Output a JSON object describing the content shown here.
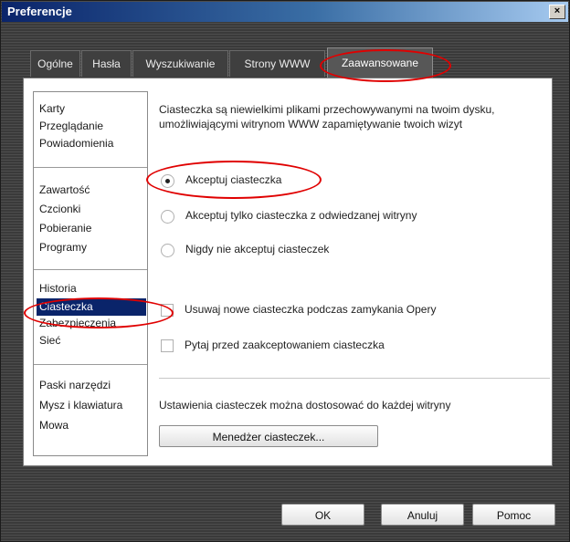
{
  "window": {
    "title": "Preferencje",
    "close_glyph": "×"
  },
  "tabs": [
    "Ogólne",
    "Hasła",
    "Wyszukiwanie",
    "Strony WWW",
    "Zaawansowane"
  ],
  "sidebar": {
    "groups": [
      [
        "Karty",
        "Przeglądanie",
        "Powiadomienia"
      ],
      [
        "Zawartość",
        "Czcionki",
        "Pobieranie",
        "Programy"
      ],
      [
        "Historia",
        "Ciasteczka",
        "Zabezpieczenia",
        "Sieć"
      ],
      [
        "Paski narzędzi",
        "Mysz i klawiatura",
        "Mowa"
      ]
    ],
    "selected": "Ciasteczka"
  },
  "content": {
    "description_line1": "Ciasteczka są niewielkimi plikami przechowywanymi na twoim dysku,",
    "description_line2": "umożliwiającymi witrynom WWW zapamiętywanie twoich wizyt",
    "radio_accept": "Akceptuj ciasteczka",
    "radio_accept_visited": "Akceptuj tylko ciasteczka z odwiedzanej witryny",
    "radio_never": "Nigdy nie akceptuj ciasteczek",
    "selected_radio": "Akceptuj ciasteczka",
    "check_delete_on_exit": "Usuwaj nowe ciasteczka podczas zamykania Opery",
    "check_ask_before": "Pytaj przed zaakceptowaniem ciasteczka",
    "per_site_text": "Ustawienia ciasteczek można dostosować do każdej witryny",
    "manager_button": "Menedżer ciasteczek..."
  },
  "footer": {
    "ok": "OK",
    "cancel": "Anuluj",
    "help": "Pomoc"
  },
  "colors": {
    "annotation": "#e00000",
    "selection": "#0a246a"
  }
}
